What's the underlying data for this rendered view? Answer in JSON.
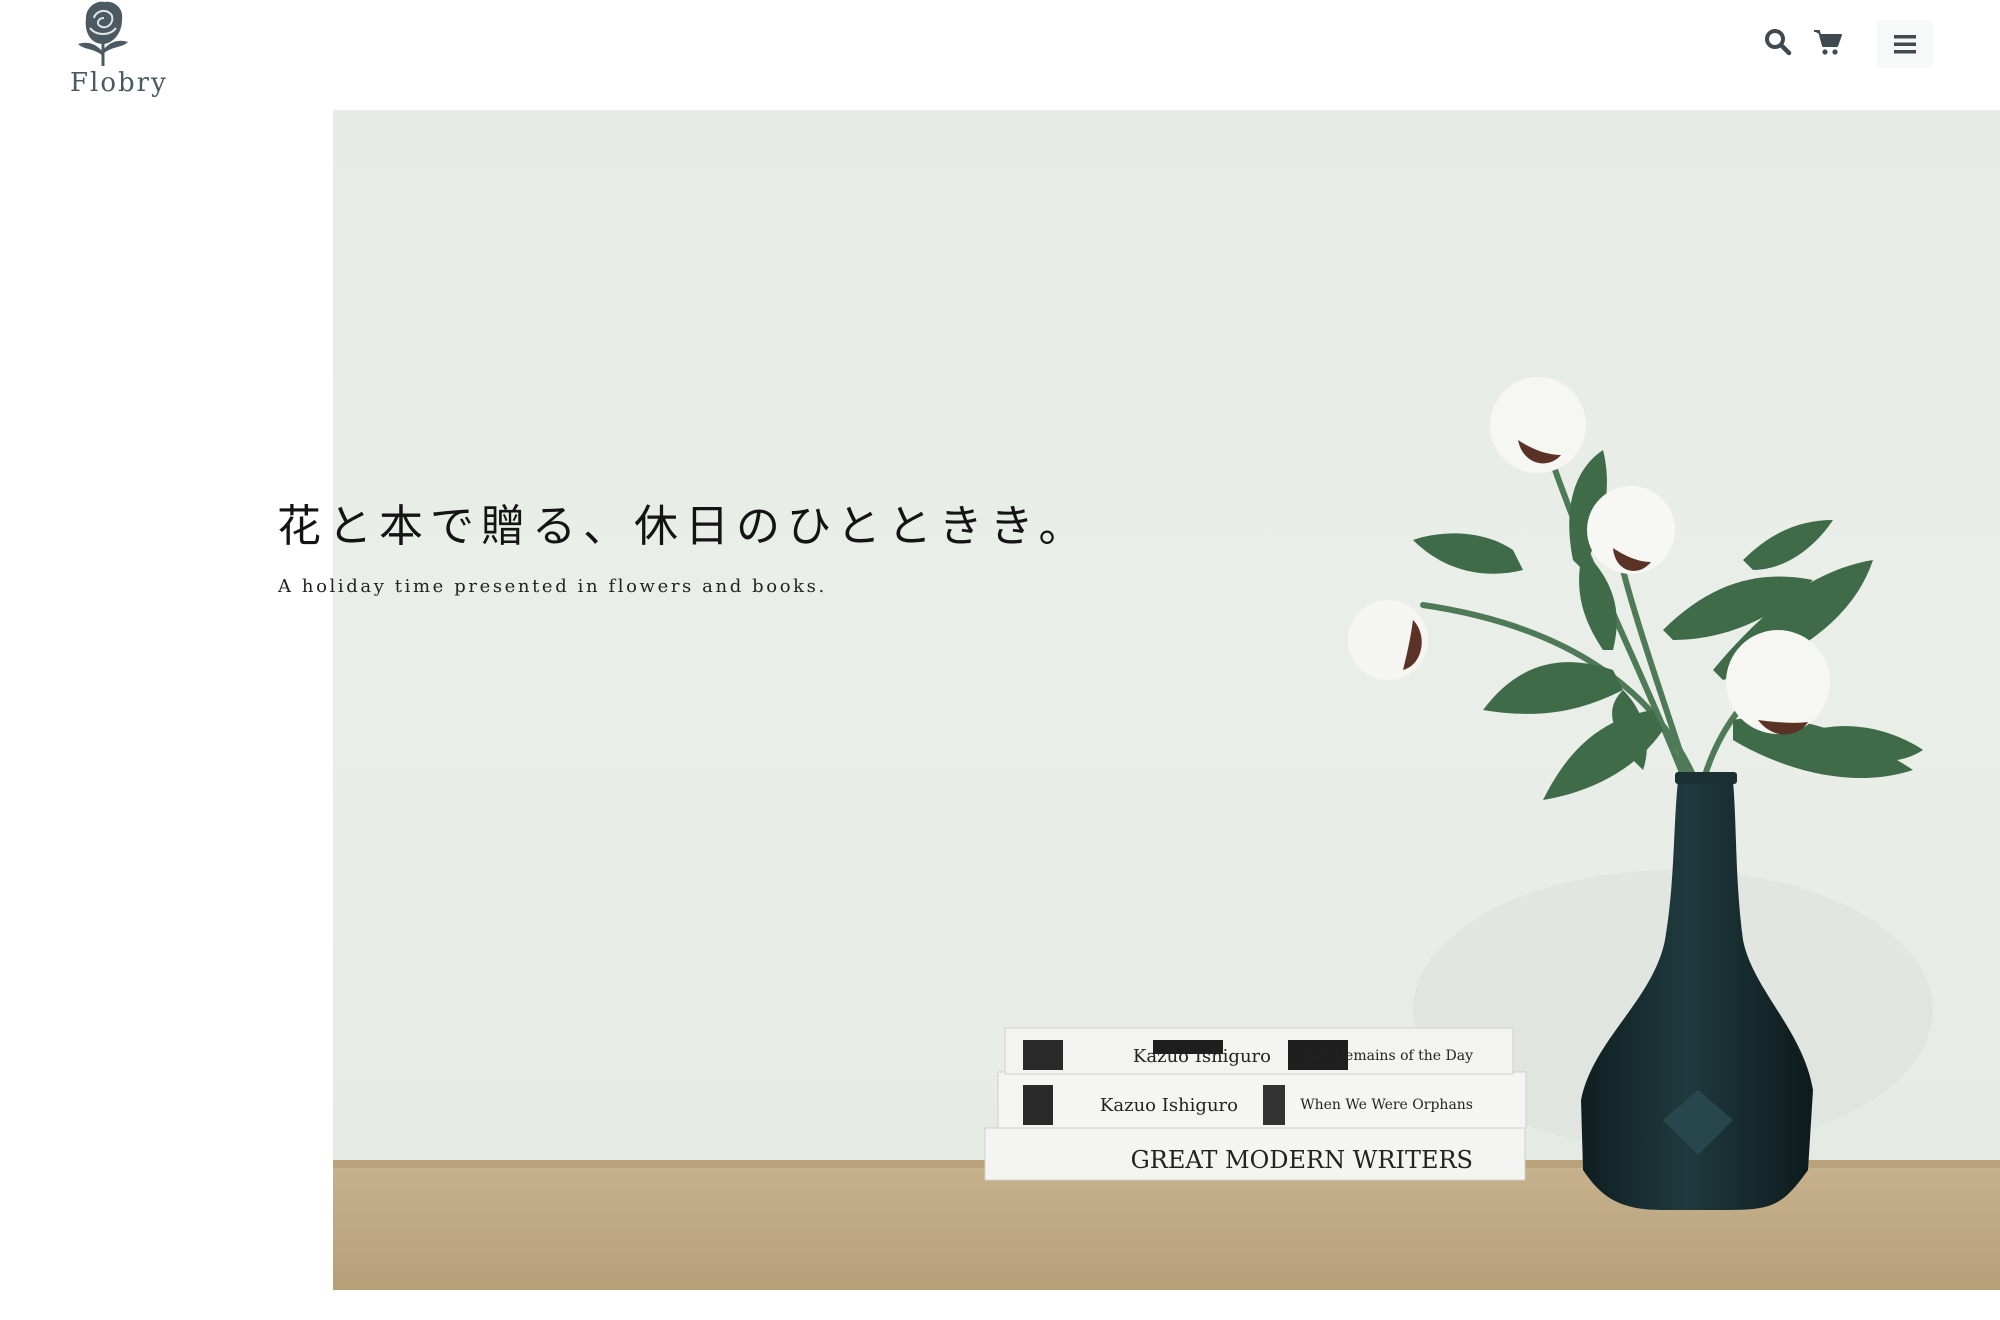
{
  "brand": {
    "name": "Flobry",
    "logo_icon": "rose-icon",
    "color": "#4b5a62"
  },
  "header": {
    "icons": [
      "search-icon",
      "cart-icon",
      "menu-icon"
    ]
  },
  "hero": {
    "title": "花と本で贈る、休日のひとときき。",
    "subtitle": "A holiday time presented in flowers and books.",
    "books": [
      {
        "title": "The Remains of the Day",
        "author": "Kazuo Ishiguro"
      },
      {
        "title": "When We Were Orphans",
        "author": "Kazuo Ishiguro"
      },
      {
        "title": "GREAT MODERN WRITERS"
      }
    ]
  },
  "colors": {
    "background": "#ffffff",
    "hero_wall": "#e8ece7",
    "vase": "#16282b",
    "leaf": "#3f6b48"
  }
}
